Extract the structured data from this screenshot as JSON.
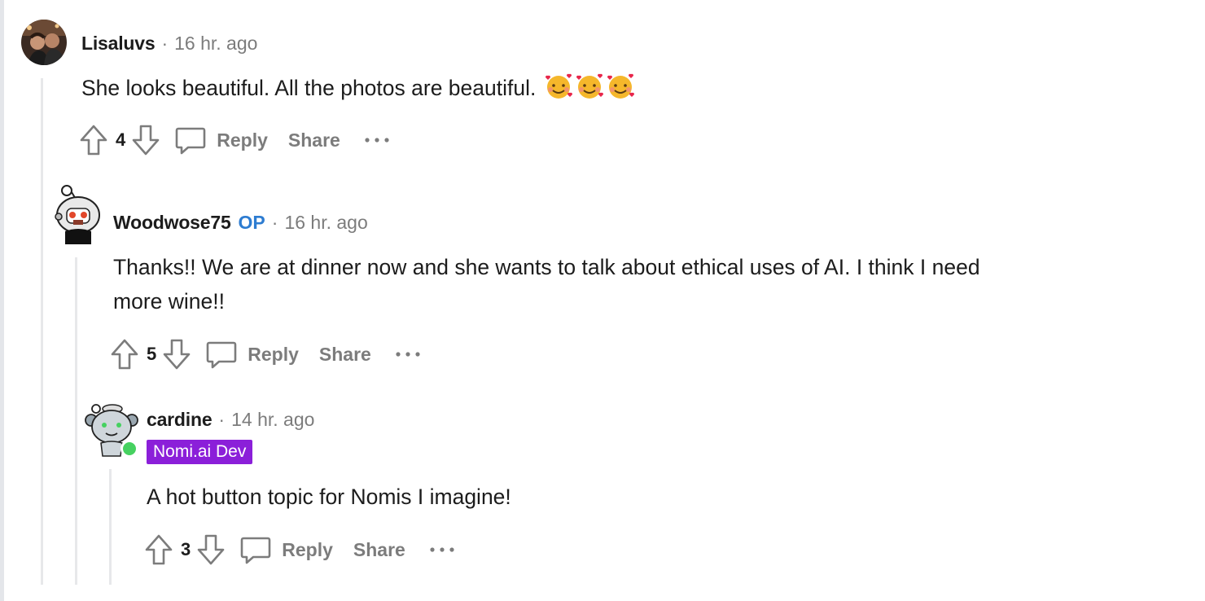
{
  "comments": [
    {
      "username": "Lisaluvs",
      "time": "16 hr. ago",
      "body": "She looks beautiful. All the photos are beautiful.",
      "emoji": [
        "smiling-face-with-hearts",
        "smiling-face-with-hearts",
        "smiling-face-with-hearts"
      ],
      "score": "4",
      "reply_label": "Reply",
      "share_label": "Share"
    },
    {
      "username": "Woodwose75",
      "badge": "OP",
      "time": "16 hr. ago",
      "body_line1": "Thanks!! We are at dinner now and she wants to talk about ethical uses of AI. I think I need",
      "body_line2": "more wine!!",
      "score": "5",
      "reply_label": "Reply",
      "share_label": "Share"
    },
    {
      "username": "cardine",
      "time": "14 hr. ago",
      "flair": "Nomi.ai Dev",
      "body": "A hot button topic for Nomis I imagine!",
      "score": "3",
      "reply_label": "Reply",
      "share_label": "Share",
      "online": true
    }
  ],
  "separator": "·",
  "colors": {
    "op": "#2d7cd1",
    "flair_bg": "#8b1fd9",
    "muted": "#7c7c7c",
    "online": "#46d160"
  }
}
